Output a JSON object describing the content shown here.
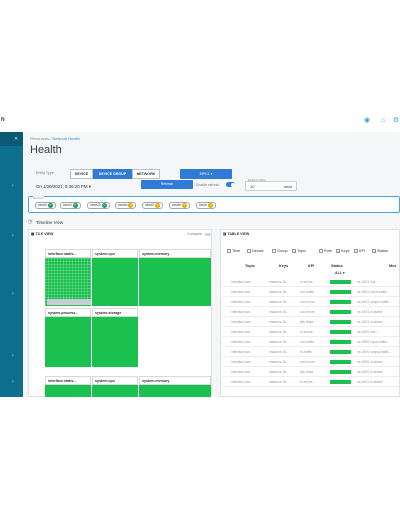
{
  "header": {
    "brand": "N",
    "icons": [
      "user-circle-icon",
      "share-icon",
      "settings-icon"
    ]
  },
  "breadcrumb": {
    "root": "Resources",
    "current": "Network Health"
  },
  "page_title": "Health",
  "entity_type": {
    "label": "Entity Type",
    "options": [
      "DEVICE",
      "DEVICE GROUP",
      "NETWORK"
    ],
    "selected": "DEVICE GROUP"
  },
  "group_dropdown": {
    "value": "MPC1"
  },
  "date": "On 1/20/2021, 8:36:20 PM",
  "refresh_button": "Refresh",
  "enable_refresh_label": "Enable refresh",
  "refresh_interval": {
    "label": "Refresh Rate",
    "value": "10",
    "unit": "secs"
  },
  "devices_chips": {
    "label": "Devices",
    "items": [
      "ceurt0",
      "ceurt1",
      "ceurt20",
      "ceurtw",
      "ceurt0",
      "ceurte",
      "ceurtr"
    ]
  },
  "timeline_label": "Timeline View",
  "tile_view": {
    "title": "TILE VIEW",
    "compare_label": "Compare",
    "tiles_row1": [
      "interface.statis...",
      "system.cpu",
      "system.memory"
    ],
    "tiles_row2": [
      "system.process...",
      "system.storage"
    ],
    "tiles_row3": [
      "interface.statis...",
      "system.cpu",
      "system.memory"
    ]
  },
  "table_view": {
    "title": "TABLE VIEW",
    "filters": [
      {
        "label": "Time",
        "checked": false
      },
      {
        "label": "Device",
        "checked": false
      },
      {
        "label": "Group",
        "checked": false
      },
      {
        "label": "Topic",
        "checked": true
      },
      {
        "label": "Rule",
        "checked": false
      },
      {
        "label": "Keys",
        "checked": true
      },
      {
        "label": "KPI",
        "checked": true
      },
      {
        "label": "Status",
        "checked": true
      }
    ],
    "columns": [
      "Topic",
      "Keys",
      "KPI",
      "Status",
      "Mes"
    ],
    "status_filter": "ALL",
    "rows": [
      {
        "topic": "interface.sta...",
        "keys": "instance-ID...",
        "kpi": "in-errors",
        "msg": "xe-0/0/1 link-..."
      },
      {
        "topic": "interface.sta...",
        "keys": "instance-ID...",
        "kpi": "out-traffic",
        "msg": "xe-0/0/1 input-traffic..."
      },
      {
        "topic": "interface.sta...",
        "keys": "instance-ID...",
        "kpi": "out-errors",
        "msg": "xe-0/0/1 output-traffic..."
      },
      {
        "topic": "interface.sta...",
        "keys": "instance-ID...",
        "kpi": "out-errors",
        "msg": "xe-0/0/1 is stable"
      },
      {
        "topic": "interface.sta...",
        "keys": "instance-ID...",
        "kpi": "link-flaps",
        "msg": "xe-0/0/1 is stable"
      },
      {
        "topic": "interface.sta...",
        "keys": "instance-ID...",
        "kpi": "in-errors",
        "msg": "xe-0/0/0 link-..."
      },
      {
        "topic": "interface.sta...",
        "keys": "instance-ID...",
        "kpi": "out-traffic",
        "msg": "xe-0/0/0 input-traffic..."
      },
      {
        "topic": "interface.sta...",
        "keys": "instance-ID...",
        "kpi": "in-traffic",
        "msg": "xe-0/0/0 output-traffic..."
      },
      {
        "topic": "interface.sta...",
        "keys": "instance-ID...",
        "kpi": "out-errors",
        "msg": "xe-0/0/0 is stable"
      },
      {
        "topic": "interface.sta...",
        "keys": "instance-ID...",
        "kpi": "link-flaps",
        "msg": "xe-0/0/0 is stable"
      },
      {
        "topic": "interface.sta...",
        "keys": "instance-ID...",
        "kpi": "in-errors",
        "msg": "xe-0/0/1 is stable"
      }
    ]
  },
  "colors": {
    "healthy": "#1bc14e",
    "accent": "#2f7bd6",
    "sidebar": "#0e6f8e"
  }
}
